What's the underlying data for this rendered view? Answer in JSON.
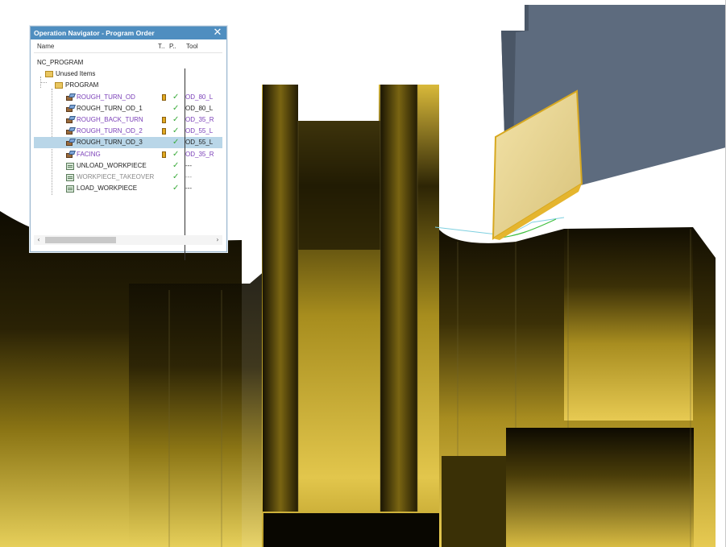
{
  "navigator": {
    "title": "Operation Navigator - Program Order",
    "close_glyph": "✕",
    "columns": {
      "name": "Name",
      "t": "T..",
      "p": "P..",
      "tool": "Tool"
    },
    "items": [
      {
        "name": "NC_PROGRAM",
        "tool": "",
        "check": "",
        "color": "dark",
        "icon": "none",
        "tbadge": false
      },
      {
        "name": "Unused Items",
        "tool": "",
        "check": "",
        "color": "dark",
        "icon": "folder-icon",
        "tbadge": false
      },
      {
        "name": "PROGRAM",
        "tool": "",
        "check": "",
        "color": "dark",
        "icon": "folder-icon",
        "tbadge": false
      },
      {
        "name": "ROUGH_TURN_OD",
        "tool": "OD_80_L",
        "check": "✓",
        "color": "purple",
        "icon": "turning-operation-icon",
        "tbadge": true
      },
      {
        "name": "ROUGH_TURN_OD_1",
        "tool": "OD_80_L",
        "check": "✓",
        "color": "dark",
        "icon": "turning-operation-icon",
        "tbadge": false
      },
      {
        "name": "ROUGH_BACK_TURN",
        "tool": "OD_35_R",
        "check": "✓",
        "color": "purple",
        "icon": "turning-operation-icon",
        "tbadge": true
      },
      {
        "name": "ROUGH_TURN_OD_2",
        "tool": "OD_55_L",
        "check": "✓",
        "color": "purple",
        "icon": "turning-operation-icon",
        "tbadge": true
      },
      {
        "name": "ROUGH_TURN_OD_3",
        "tool": "OD_55_L",
        "check": "✓",
        "color": "dark",
        "icon": "turning-operation-icon",
        "tbadge": false,
        "selected": true
      },
      {
        "name": "FACING",
        "tool": "OD_35_R",
        "check": "✓",
        "color": "purple",
        "icon": "turning-operation-icon",
        "tbadge": true
      },
      {
        "name": "UNLOAD_WORKPIECE",
        "tool": "---",
        "check": "✓",
        "color": "dark",
        "icon": "workpiece-operation-icon",
        "tbadge": false
      },
      {
        "name": "WORKPIECE_TAKEOVER",
        "tool": "---",
        "check": "✓",
        "color": "grey",
        "icon": "workpiece-operation-icon",
        "tbadge": false
      },
      {
        "name": "LOAD_WORKPIECE",
        "tool": "---",
        "check": "✓",
        "color": "dark",
        "icon": "workpiece-operation-icon",
        "tbadge": false
      }
    ],
    "scroll": {
      "left_glyph": "‹",
      "right_glyph": "›"
    }
  },
  "colors": {
    "part_gold": "#e8c24a",
    "part_dark": "#171302",
    "tool_holder": "#5d6b7e",
    "insert_gold": "#e5b52e",
    "toolpath_cyan": "#7fd0e0",
    "toolpath_green": "#3fbf3f",
    "titlebar": "#4f8ec0",
    "selection": "#b9d6e8"
  }
}
